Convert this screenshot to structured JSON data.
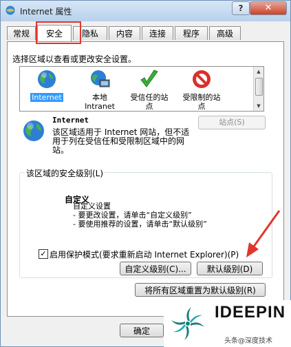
{
  "window": {
    "title": "Internet 属性",
    "help_label": "?",
    "close_label": "✕"
  },
  "tabs": [
    "常规",
    "安全",
    "隐私",
    "内容",
    "连接",
    "程序",
    "高级"
  ],
  "active_tab": "安全",
  "prompt": "选择区域以查看或更改安全设置。",
  "zones": [
    {
      "label": "Internet",
      "icon": "globe-icon"
    },
    {
      "label": "本地\nIntranet",
      "icon": "intranet-icon"
    },
    {
      "label": "受信任的站\n点",
      "icon": "checkmark-icon"
    },
    {
      "label": "受限制的站\n点",
      "icon": "restricted-icon"
    }
  ],
  "selected_zone": {
    "title": "Internet",
    "description": "该区域适用于 Internet 网站，但不适用于列在受信任和受限制区域中的网站。",
    "sites_button": "站点(S)"
  },
  "security_level": {
    "legend": "该区域的安全级别(L)",
    "name": "自定义",
    "lines": [
      "自定义设置",
      "- 要更改设置，请单击“自定义级别”",
      "- 要使用推荐的设置，请单击“默认级别”"
    ]
  },
  "protected_mode": {
    "label": "启用保护模式(要求重新启动 Internet Explorer)(P)",
    "checked": true
  },
  "buttons": {
    "custom_level": "自定义级别(C)...",
    "default_level": "默认级别(D)",
    "reset_all": "将所有区域重置为默认级别(R)",
    "ok": "确定"
  },
  "watermark": {
    "brand": "IDEEPIN",
    "sub": "头条@深度技术"
  },
  "colors": {
    "highlight_border": "#e0362e",
    "arrow": "#e0362e",
    "selected_bg": "#3399ff"
  }
}
